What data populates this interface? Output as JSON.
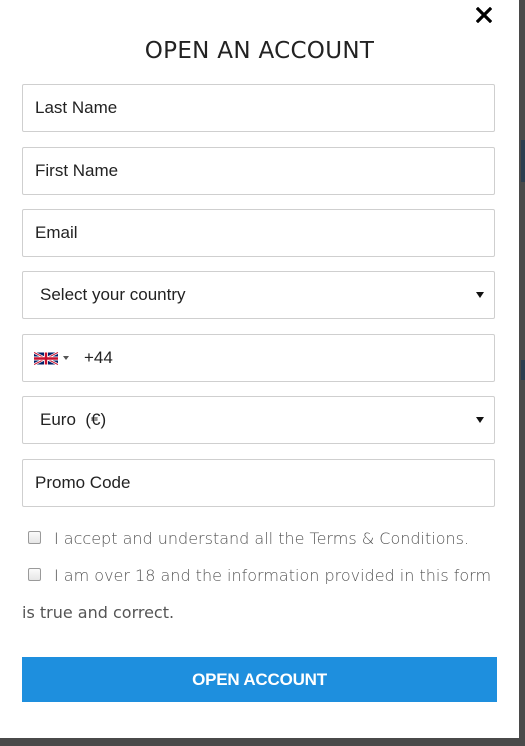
{
  "modal": {
    "title": "OPEN AN ACCOUNT",
    "close_icon": "close-icon"
  },
  "form": {
    "last_name": {
      "placeholder": "Last Name",
      "value": ""
    },
    "first_name": {
      "placeholder": "First Name",
      "value": ""
    },
    "email": {
      "placeholder": "Email",
      "value": ""
    },
    "country": {
      "selected": "Select your country"
    },
    "phone": {
      "flag": "uk-flag-icon",
      "prefix": "+44"
    },
    "currency": {
      "selected": "Euro  (€)"
    },
    "promo": {
      "placeholder": "Promo Code",
      "value": ""
    }
  },
  "checks": {
    "terms_label": "I accept and understand all the Terms & Conditions.",
    "age_label": "I am over 18 and the information provided in this form",
    "age_label_cont": "is true and correct.",
    "terms_checked": false,
    "age_checked": false
  },
  "submit": {
    "label": "OPEN ACCOUNT"
  },
  "colors": {
    "accent": "#1e8fde",
    "backdrop": "#4a4a4a",
    "border": "#cfcfcf"
  }
}
